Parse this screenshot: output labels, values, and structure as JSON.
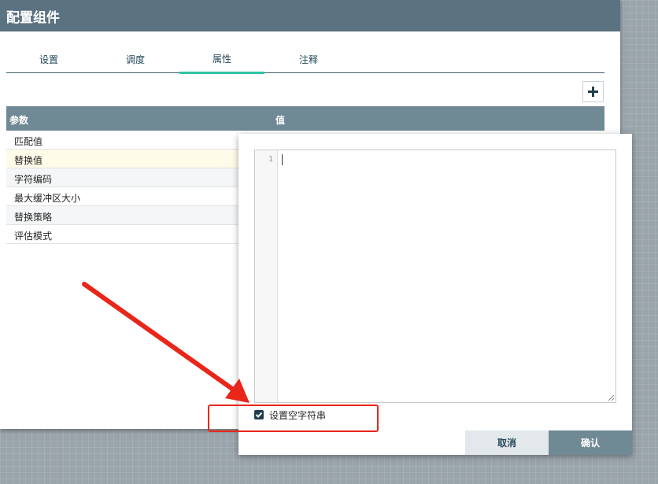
{
  "dialog": {
    "title": "配置组件",
    "tabs": [
      {
        "label": "设置",
        "active": false
      },
      {
        "label": "调度",
        "active": false
      },
      {
        "label": "属性",
        "active": true
      },
      {
        "label": "注释",
        "active": false
      }
    ],
    "table": {
      "headers": [
        "参数",
        "值"
      ],
      "rows": [
        "匹配值",
        "替换值",
        "字符编码",
        "最大缓冲区大小",
        "替换策略",
        "评估模式"
      ],
      "selected_row": "替换值"
    }
  },
  "editor": {
    "line_numbers": [
      "1"
    ],
    "empty_string_label": "设置空字符串",
    "empty_string_checked": true,
    "cancel_label": "取消",
    "ok_label": "确认"
  },
  "icons": {
    "add": "plus-icon",
    "check": "check-icon",
    "resize": "resize-grip-icon"
  },
  "colors": {
    "header": "#5b7280",
    "table_header": "#6f8995",
    "active_tab": "#2ec4a5",
    "highlight_annotation": "#e8261a",
    "ok_button": "#6f8995",
    "cancel_button": "#e3e8eb"
  }
}
